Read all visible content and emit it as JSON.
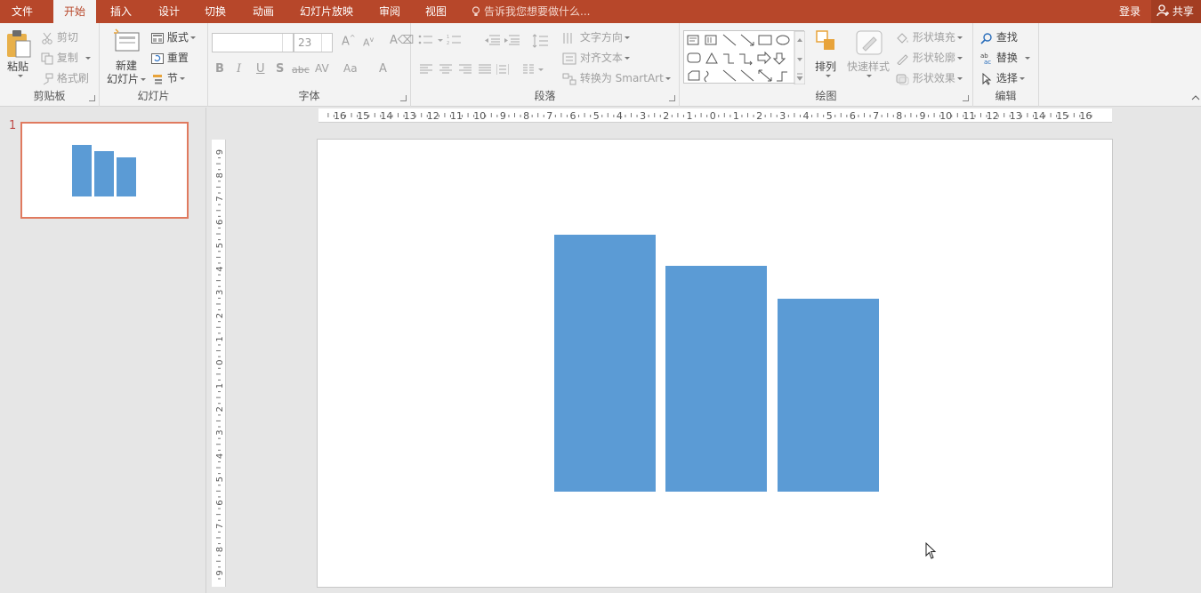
{
  "tabs": [
    {
      "label": "文件",
      "active": false
    },
    {
      "label": "开始",
      "active": true
    },
    {
      "label": "插入",
      "active": false
    },
    {
      "label": "设计",
      "active": false
    },
    {
      "label": "切换",
      "active": false
    },
    {
      "label": "动画",
      "active": false
    },
    {
      "label": "幻灯片放映",
      "active": false
    },
    {
      "label": "审阅",
      "active": false
    },
    {
      "label": "视图",
      "active": false
    }
  ],
  "tell_me": "告诉我您想要做什么...",
  "login": "登录",
  "share": "共享",
  "clipboard": {
    "paste": "粘贴",
    "cut": "剪切",
    "copy": "复制",
    "format_painter": "格式刷",
    "group_label": "剪贴板"
  },
  "slides_group": {
    "new_slide_line1": "新建",
    "new_slide_line2": "幻灯片",
    "layout": "版式",
    "reset": "重置",
    "section": "节",
    "group_label": "幻灯片"
  },
  "font": {
    "font_name": "",
    "font_size": "23",
    "group_label": "字体"
  },
  "paragraph": {
    "text_direction": "文字方向",
    "align_text": "对齐文本",
    "convert_smartart": "转换为 SmartArt",
    "group_label": "段落"
  },
  "drawing": {
    "arrange": "排列",
    "quick_styles": "快速样式",
    "shape_fill": "形状填充",
    "shape_outline": "形状轮廓",
    "shape_effects": "形状效果",
    "group_label": "绘图"
  },
  "editing": {
    "find": "查找",
    "replace": "替换",
    "select": "选择",
    "group_label": "编辑"
  },
  "thumbnail": {
    "slide_number": "1"
  },
  "ruler": {
    "horizontal_labels": [
      "16",
      "15",
      "14",
      "13",
      "12",
      "11",
      "10",
      "9",
      "8",
      "7",
      "6",
      "5",
      "4",
      "3",
      "2",
      "1",
      "0",
      "1",
      "2",
      "3",
      "4",
      "5",
      "6",
      "7",
      "8",
      "9",
      "10",
      "11",
      "12",
      "13",
      "14",
      "15",
      "16"
    ],
    "vertical_labels": [
      "9",
      "8",
      "7",
      "6",
      "5",
      "4",
      "3",
      "2",
      "1",
      "0",
      "1",
      "2",
      "3",
      "4",
      "5",
      "6",
      "7",
      "8",
      "9"
    ]
  },
  "slide_shapes": {
    "fill_color": "#5b9bd5",
    "bar_heights_relative": [
      1.0,
      0.88,
      0.755
    ]
  },
  "colors": {
    "accent": "#b7472a",
    "selection": "#e07a5f",
    "shape_blue": "#5b9bd5"
  }
}
